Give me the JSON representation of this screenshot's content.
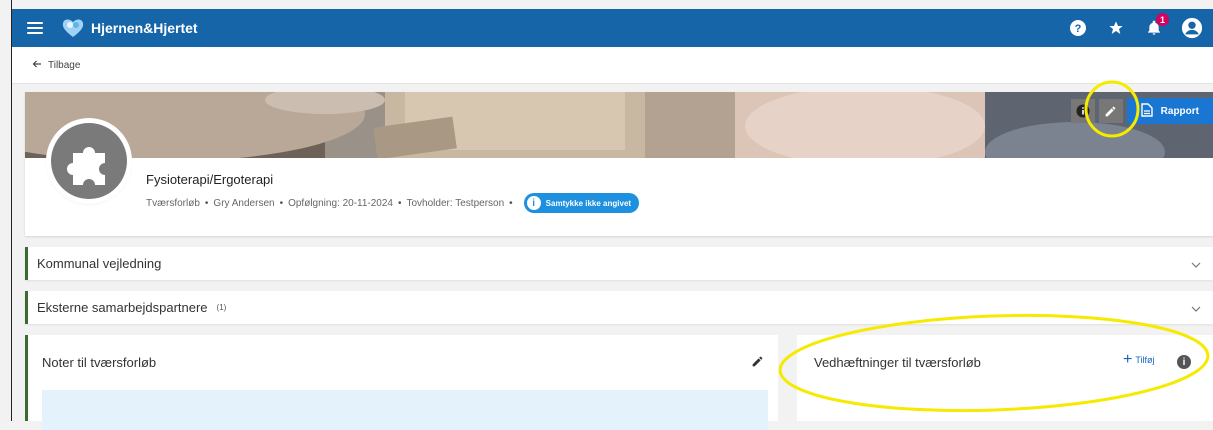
{
  "app": {
    "brand": "Hjernen&Hjertet",
    "notification_count": "1"
  },
  "nav": {
    "back_label": "Tilbage"
  },
  "profile": {
    "title": "Fysioterapi/Ergoterapi",
    "meta": [
      "Tværsforløb",
      "Gry Andersen",
      "Opfølgning: 20-11-2024",
      "Tovholder: Testperson"
    ],
    "consent_label": "Samtykke ikke angivet",
    "rapport_label": "Rapport"
  },
  "sections": [
    {
      "label": "Kommunal vejledning",
      "count": ""
    },
    {
      "label": "Eksterne samarbejdspartnere",
      "count": "(1)"
    }
  ],
  "notes": {
    "title": "Noter til tværsforløb"
  },
  "attachments": {
    "title": "Vedhæftninger til tværsforløb",
    "add_label": "Tilføj"
  },
  "colors": {
    "appbar": "#1565a8",
    "accent_green": "#3a6b2f",
    "consent_blue": "#1e90e0",
    "badge_pink": "#d6005f",
    "annotation_yellow": "#f5ea00"
  }
}
